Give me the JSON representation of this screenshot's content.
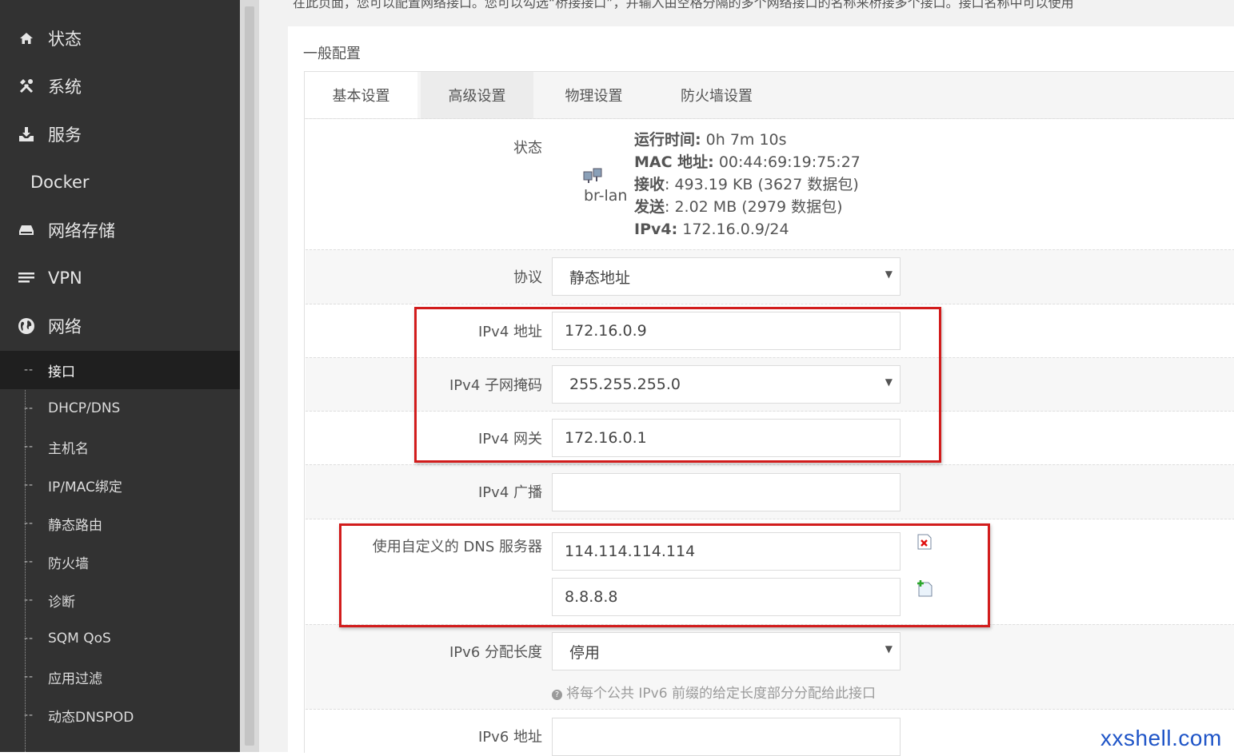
{
  "sidebar": {
    "menu": [
      {
        "label": "状态",
        "icon": "home-icon"
      },
      {
        "label": "系统",
        "icon": "tools-icon"
      },
      {
        "label": "服务",
        "icon": "download-icon"
      },
      {
        "label": "Docker",
        "icon": ""
      },
      {
        "label": "网络存储",
        "icon": "drive-icon"
      },
      {
        "label": "VPN",
        "icon": "list-icon"
      },
      {
        "label": "网络",
        "icon": "globe-icon"
      }
    ],
    "submenu": [
      {
        "label": "接口",
        "active": true
      },
      {
        "label": "DHCP/DNS"
      },
      {
        "label": "主机名"
      },
      {
        "label": "IP/MAC绑定"
      },
      {
        "label": "静态路由"
      },
      {
        "label": "防火墙"
      },
      {
        "label": "诊断"
      },
      {
        "label": "SQM QoS"
      },
      {
        "label": "应用过滤"
      },
      {
        "label": "动态DNSPOD"
      }
    ]
  },
  "intro_text": "在此页面，您可以配置网络接口。您可以勾选“桥接接口”，并输入由空格分隔的多个网络接口的名称来桥接多个接口。接口名称中可以使用",
  "section_title": "一般配置",
  "tabs": [
    "基本设置",
    "高级设置",
    "物理设置",
    "防火墙设置"
  ],
  "status": {
    "label": "状态",
    "iface": "br-lan",
    "uptime_key": "运行时间:",
    "uptime_val": " 0h 7m 10s",
    "mac_key": "MAC 地址:",
    "mac_val": " 00:44:69:19:75:27",
    "rx_key": "接收",
    "rx_val": ": 493.19 KB (3627 数据包)",
    "tx_key": "发送",
    "tx_val": ": 2.02 MB (2979 数据包)",
    "ipv4_key": "IPv4:",
    "ipv4_val": " 172.16.0.9/24"
  },
  "form": {
    "protocol_label": "协议",
    "protocol_value": "静态地址",
    "ipv4_addr_label": "IPv4 地址",
    "ipv4_addr_value": "172.16.0.9",
    "netmask_label": "IPv4 子网掩码",
    "netmask_value": "255.255.255.0",
    "gateway_label": "IPv4 网关",
    "gateway_value": "172.16.0.1",
    "broadcast_label": "IPv4 广播",
    "broadcast_value": "",
    "dns_label": "使用自定义的 DNS 服务器",
    "dns_values": [
      "114.114.114.114",
      "8.8.8.8"
    ],
    "ipv6_assign_label": "IPv6 分配长度",
    "ipv6_assign_value": "停用",
    "ipv6_assign_help": "将每个公共 IPv6 前缀的给定长度部分分配给此接口",
    "ipv6_addr_label": "IPv6 地址",
    "ipv6_addr_value": ""
  },
  "colors": {
    "highlight_box": "#d21c1c",
    "sidebar_bg": "#323232",
    "watermark": "#1e54c7"
  },
  "watermark": "xxshell.com"
}
